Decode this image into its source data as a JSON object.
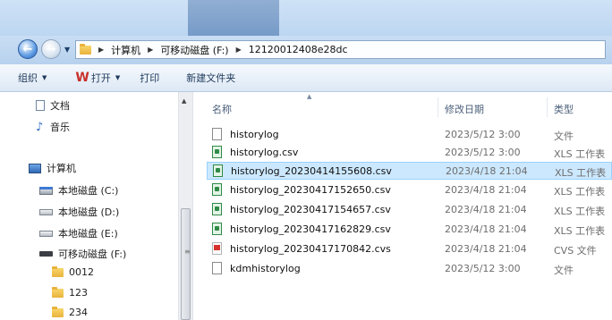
{
  "address_bar": {
    "crumbs": [
      "计算机",
      "可移动磁盘 (F:)",
      "12120012408e28dc"
    ]
  },
  "toolbar": {
    "organize": "组织",
    "open": "打开",
    "print": "打印",
    "new_folder": "新建文件夹"
  },
  "nav": {
    "items": [
      {
        "label": "文档",
        "icon": "document-icon"
      },
      {
        "label": "音乐",
        "icon": "music-icon"
      },
      {
        "label": "计算机",
        "icon": "computer-icon"
      },
      {
        "label": "本地磁盘 (C:)",
        "icon": "system-drive-icon"
      },
      {
        "label": "本地磁盘 (D:)",
        "icon": "drive-icon"
      },
      {
        "label": "本地磁盘 (E:)",
        "icon": "drive-icon"
      },
      {
        "label": "可移动磁盘 (F:)",
        "icon": "removable-drive-icon"
      },
      {
        "label": "0012",
        "icon": "folder-icon"
      },
      {
        "label": "123",
        "icon": "folder-icon"
      },
      {
        "label": "234",
        "icon": "folder-icon"
      }
    ]
  },
  "columns": {
    "name": "名称",
    "date": "修改日期",
    "type": "类型"
  },
  "files": [
    {
      "name": "historylog",
      "date": "2023/5/12 3:00",
      "type": "文件",
      "icon": "file-icon"
    },
    {
      "name": "historylog.csv",
      "date": "2023/5/12 3:00",
      "type": "XLS 工作表",
      "icon": "xls-icon"
    },
    {
      "name": "historylog_20230414155608.csv",
      "date": "2023/4/18 21:04",
      "type": "XLS 工作表",
      "icon": "xls-icon",
      "selected": true
    },
    {
      "name": "historylog_20230417152650.csv",
      "date": "2023/4/18 21:04",
      "type": "XLS 工作表",
      "icon": "xls-icon"
    },
    {
      "name": "historylog_20230417154657.csv",
      "date": "2023/4/18 21:04",
      "type": "XLS 工作表",
      "icon": "xls-icon"
    },
    {
      "name": "historylog_20230417162829.csv",
      "date": "2023/4/18 21:04",
      "type": "XLS 工作表",
      "icon": "xls-icon"
    },
    {
      "name": "historylog_20230417170842.cvs",
      "date": "2023/4/18 21:04",
      "type": "CVS 文件",
      "icon": "cvs-icon"
    },
    {
      "name": "kdmhistorylog",
      "date": "2023/5/12 3:00",
      "type": "文件",
      "icon": "file-icon"
    }
  ],
  "colors": {
    "selection": "#cce8ff",
    "selection_border": "#99d1ff",
    "open_icon": "#c8302a"
  }
}
